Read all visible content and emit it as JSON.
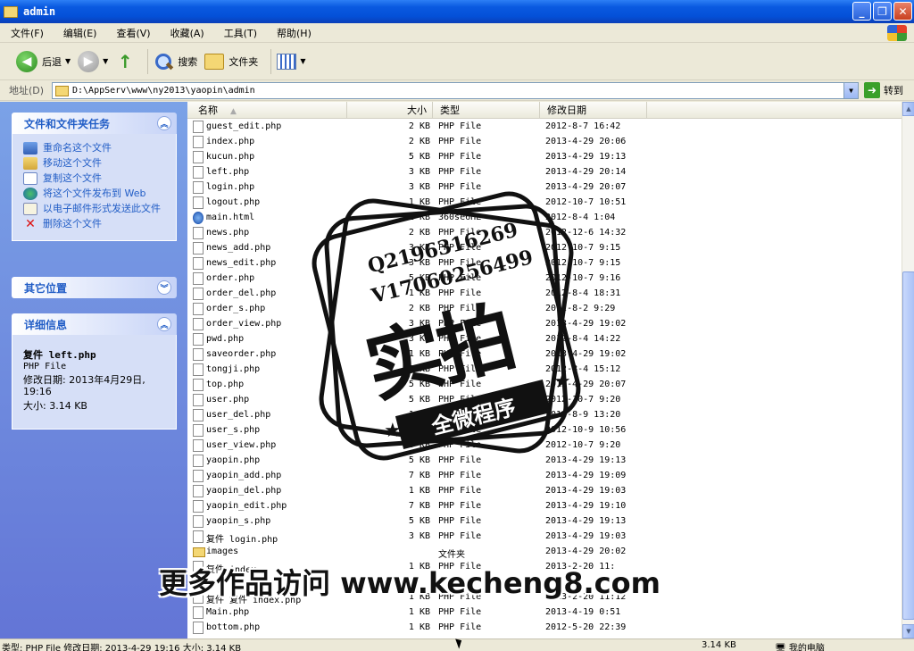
{
  "window": {
    "title": "admin"
  },
  "menu": [
    "文件(F)",
    "编辑(E)",
    "查看(V)",
    "收藏(A)",
    "工具(T)",
    "帮助(H)"
  ],
  "toolbar": {
    "back": "后退",
    "search": "搜索",
    "folders": "文件夹"
  },
  "address": {
    "label": "地址(D)",
    "path": "D:\\AppServ\\www\\ny2013\\yaopin\\admin",
    "go": "转到"
  },
  "tasks": {
    "header": "文件和文件夹任务",
    "items": [
      "重命名这个文件",
      "移动这个文件",
      "复制这个文件",
      "将这个文件发布到 Web",
      "以电子邮件形式发送此文件",
      "删除这个文件"
    ]
  },
  "other_places": {
    "header": "其它位置"
  },
  "details": {
    "header": "详细信息",
    "name": "复件 left.php",
    "type": "PHP File",
    "modified": "修改日期: 2013年4月29日, 19:16",
    "size": "大小: 3.14 KB"
  },
  "columns": {
    "name": "名称",
    "size": "大小",
    "type": "类型",
    "date": "修改日期"
  },
  "files": [
    {
      "name": "guest_edit.php",
      "size": "2 KB",
      "type": "PHP File",
      "date": "2012-8-7 16:42",
      "icon": "php"
    },
    {
      "name": "index.php",
      "size": "2 KB",
      "type": "PHP File",
      "date": "2013-4-29 20:06",
      "icon": "php"
    },
    {
      "name": "kucun.php",
      "size": "5 KB",
      "type": "PHP File",
      "date": "2013-4-29 19:13",
      "icon": "php"
    },
    {
      "name": "left.php",
      "size": "3 KB",
      "type": "PHP File",
      "date": "2013-4-29 20:14",
      "icon": "php"
    },
    {
      "name": "login.php",
      "size": "3 KB",
      "type": "PHP File",
      "date": "2013-4-29 20:07",
      "icon": "php"
    },
    {
      "name": "logout.php",
      "size": "1 KB",
      "type": "PHP File",
      "date": "2012-10-7 10:51",
      "icon": "php"
    },
    {
      "name": "main.html",
      "size": "1 KB",
      "type": "360se6HL",
      "date": "2012-8-4 1:04",
      "icon": "html"
    },
    {
      "name": "news.php",
      "size": "2 KB",
      "type": "PHP File",
      "date": "2012-12-6 14:32",
      "icon": "php"
    },
    {
      "name": "news_add.php",
      "size": "3 KB",
      "type": "PHP File",
      "date": "2012-10-7 9:15",
      "icon": "php"
    },
    {
      "name": "news_edit.php",
      "size": "3 KB",
      "type": "PHP File",
      "date": "2012-10-7 9:15",
      "icon": "php"
    },
    {
      "name": "order.php",
      "size": "5 KB",
      "type": "PHP File",
      "date": "2012-10-7 9:16",
      "icon": "php"
    },
    {
      "name": "order_del.php",
      "size": "1 KB",
      "type": "PHP File",
      "date": "2012-8-4 18:31",
      "icon": "php"
    },
    {
      "name": "order_s.php",
      "size": "2 KB",
      "type": "PHP File",
      "date": "2012-8-2 9:29",
      "icon": "php"
    },
    {
      "name": "order_view.php",
      "size": "3 KB",
      "type": "PHP File",
      "date": "2013-4-29 19:02",
      "icon": "php"
    },
    {
      "name": "pwd.php",
      "size": "3 KB",
      "type": "PHP File",
      "date": "2012-8-4 14:22",
      "icon": "php"
    },
    {
      "name": "saveorder.php",
      "size": "1 KB",
      "type": "PHP File",
      "date": "2013-4-29 19:02",
      "icon": "php"
    },
    {
      "name": "tongji.php",
      "size": "3 KB",
      "type": "PHP File",
      "date": "2012-8-4 15:12",
      "icon": "php"
    },
    {
      "name": "top.php",
      "size": "5 KB",
      "type": "PHP File",
      "date": "2013-4-29 20:07",
      "icon": "php"
    },
    {
      "name": "user.php",
      "size": "5 KB",
      "type": "PHP File",
      "date": "2012-10-7 9:20",
      "icon": "php"
    },
    {
      "name": "user_del.php",
      "size": "1 KB",
      "type": "PHP File",
      "date": "2012-8-9 13:20",
      "icon": "php"
    },
    {
      "name": "user_s.php",
      "size": "3 KB",
      "type": "PHP File",
      "date": "2012-10-9 10:56",
      "icon": "php"
    },
    {
      "name": "user_view.php",
      "size": "3 KB",
      "type": "PHP File",
      "date": "2012-10-7 9:20",
      "icon": "php"
    },
    {
      "name": "yaopin.php",
      "size": "5 KB",
      "type": "PHP File",
      "date": "2013-4-29 19:13",
      "icon": "php"
    },
    {
      "name": "yaopin_add.php",
      "size": "7 KB",
      "type": "PHP File",
      "date": "2013-4-29 19:09",
      "icon": "php"
    },
    {
      "name": "yaopin_del.php",
      "size": "1 KB",
      "type": "PHP File",
      "date": "2013-4-29 19:03",
      "icon": "php"
    },
    {
      "name": "yaopin_edit.php",
      "size": "7 KB",
      "type": "PHP File",
      "date": "2013-4-29 19:10",
      "icon": "php"
    },
    {
      "name": "yaopin_s.php",
      "size": "5 KB",
      "type": "PHP File",
      "date": "2013-4-29 19:13",
      "icon": "php"
    },
    {
      "name": "复件 login.php",
      "size": "3 KB",
      "type": "PHP File",
      "date": "2013-4-29 19:03",
      "icon": "php"
    },
    {
      "name": "images",
      "size": "",
      "type": "文件夹",
      "date": "2013-4-29 20:02",
      "icon": "folder"
    },
    {
      "name": "复件 index",
      "size": "1 KB",
      "type": "PHP File",
      "date": "2013-2-20 11:",
      "icon": "php"
    },
    {
      "name": "",
      "size": "",
      "type": "",
      "date": "",
      "icon": "php"
    },
    {
      "name": "复件 复件 index.php",
      "size": "1 KB",
      "type": "PHP File",
      "date": "2013-2-20 11:12",
      "icon": "php"
    },
    {
      "name": "Main.php",
      "size": "1 KB",
      "type": "PHP File",
      "date": "2013-4-19 0:51",
      "icon": "php"
    },
    {
      "name": "bottom.php",
      "size": "1 KB",
      "type": "PHP File",
      "date": "2012-5-20 22:39",
      "icon": "php"
    }
  ],
  "status": {
    "left": "类型: PHP File 修改日期: 2013-4-29 19:16 大小: 3.14 KB",
    "size": "3.14 KB",
    "location": "我的电脑"
  },
  "watermark": {
    "qq": "Q2196316269",
    "v": "V17060256499",
    "big": "实拍",
    "ribbon": "全微程序",
    "banner": "更多作品访问 www.kecheng8.com"
  }
}
